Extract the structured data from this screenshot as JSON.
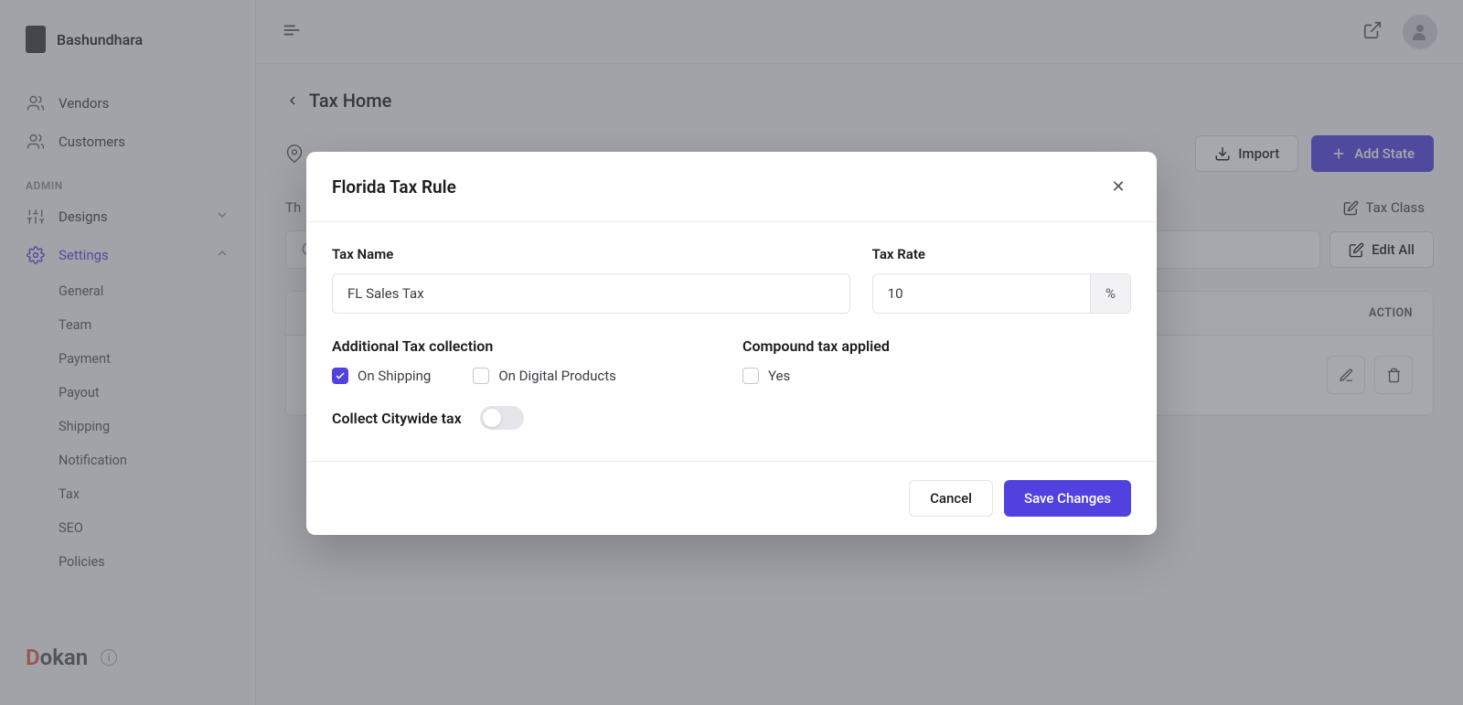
{
  "sidebar": {
    "brand": "Bashundhara",
    "items": {
      "vendors": "Vendors",
      "customers": "Customers"
    },
    "adminLabel": "ADMIN",
    "designs": "Designs",
    "settings": "Settings",
    "subItems": {
      "general": "General",
      "team": "Team",
      "payment": "Payment",
      "payout": "Payout",
      "shipping": "Shipping",
      "notification": "Notification",
      "tax": "Tax",
      "seo": "SEO",
      "policies": "Policies"
    },
    "footerBrand": "okan"
  },
  "content": {
    "breadcrumb": "Tax Home",
    "descriptionPrefix": "Th",
    "importBtn": "Import",
    "addStateBtn": "Add State",
    "taxClass": "Tax Class",
    "editAll": "Edit All",
    "table": {
      "actionHeader": "ACTION"
    }
  },
  "modal": {
    "title": "Florida Tax Rule",
    "taxNameLabel": "Tax Name",
    "taxNameValue": "FL Sales Tax",
    "taxRateLabel": "Tax Rate",
    "taxRateValue": "10",
    "rateSuffix": "%",
    "additionalLabel": "Additional Tax collection",
    "onShipping": "On Shipping",
    "onDigital": "On Digital Products",
    "compoundLabel": "Compound tax applied",
    "compoundYes": "Yes",
    "collectCitywide": "Collect Citywide tax",
    "cancel": "Cancel",
    "save": "Save Changes"
  }
}
